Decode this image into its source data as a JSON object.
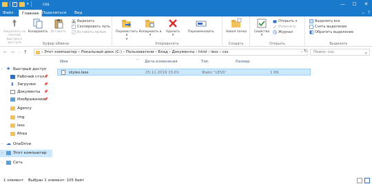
{
  "window": {
    "title": "css",
    "minimize": "—",
    "maximize": "☐",
    "close": "✕"
  },
  "tabs": {
    "file": "Файл",
    "home": "Главная",
    "share": "Поделиться",
    "view": "Вид"
  },
  "ribbon": {
    "clipboard": {
      "label": "Буфер обмена",
      "pin": "Закрепить на панели быстрого доступа",
      "copy": "Копировать",
      "paste": "Вставить",
      "cut": "Вырезать",
      "copy_path": "Скопировать путь",
      "paste_shortcut": "Вставить ярлык"
    },
    "organize": {
      "label": "Упорядочить",
      "move_to": "Переместить в",
      "copy_to": "Копировать в",
      "delete": "Удалить",
      "rename": "Переименовать"
    },
    "new": {
      "label": "Создать",
      "new_folder": "Новая папка"
    },
    "open": {
      "label": "Открыть",
      "properties": "Свойства",
      "open": "Открыть",
      "edit": "Изменить",
      "history": "Журнал"
    },
    "select": {
      "label": "Выделить",
      "select_all": "Выделить все",
      "select_none": "Снять выделение",
      "invert": "Обратить выделение"
    }
  },
  "address": {
    "path": "›  Этот компьютер  ›  Локальный диск (C:)  ›  Пользователи  ›  Влад  ›  Документы  ›  html  ›  less  ›  css",
    "search_placeholder": "Поиск: css"
  },
  "nav": {
    "items": [
      {
        "label": "Быстрый доступ"
      },
      {
        "label": "Рабочий стол"
      },
      {
        "label": "Загрузки"
      },
      {
        "label": "Документы"
      },
      {
        "label": "Изображения"
      },
      {
        "label": "Agency"
      },
      {
        "label": "img"
      },
      {
        "label": "less"
      },
      {
        "label": "Rhea"
      },
      {
        "label": "OneDrive"
      },
      {
        "label": "Этот компьютер"
      },
      {
        "label": "Сеть"
      }
    ]
  },
  "list": {
    "columns": {
      "name": "Имя",
      "date": "Дата изменения",
      "type": "Тип",
      "size": "Размер"
    },
    "rows": [
      {
        "name": "styles.less",
        "date": "25.11.2019 15:01",
        "type": "Файл \"LESS\"",
        "size": "1 КБ"
      }
    ]
  },
  "status": {
    "count": "1 элемент",
    "selected": "Выбран 1 элемент: 105 байт"
  },
  "colors": {
    "titlebar": "#1979ca",
    "selection": "#cce8ff",
    "folder": "#f1c15b"
  }
}
